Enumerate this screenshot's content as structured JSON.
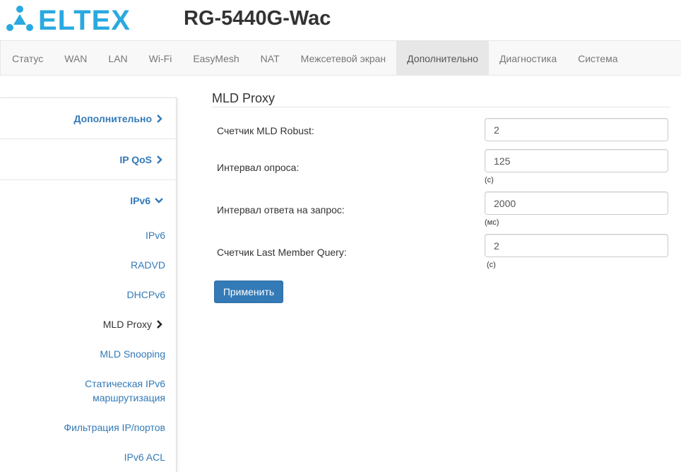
{
  "brand": {
    "logo_text": "ELTEX",
    "accent_color": "#2aa9e0"
  },
  "device_title": "RG-5440G-Wac",
  "nav": [
    {
      "label": "Статус",
      "active": false
    },
    {
      "label": "WAN",
      "active": false
    },
    {
      "label": "LAN",
      "active": false
    },
    {
      "label": "Wi-Fi",
      "active": false
    },
    {
      "label": "EasyMesh",
      "active": false
    },
    {
      "label": "NAT",
      "active": false
    },
    {
      "label": "Межсетевой экран",
      "active": false
    },
    {
      "label": "Дополнительно",
      "active": true
    },
    {
      "label": "Диагностика",
      "active": false
    },
    {
      "label": "Система",
      "active": false
    }
  ],
  "sidebar": {
    "groups": [
      {
        "label": "Дополнительно",
        "icon": "chevron-right-icon"
      },
      {
        "label": "IP QoS",
        "icon": "chevron-right-icon"
      },
      {
        "label": "IPv6",
        "icon": "chevron-down-icon"
      }
    ],
    "items": [
      {
        "label": "IPv6"
      },
      {
        "label": "RADVD"
      },
      {
        "label": "DHCPv6"
      },
      {
        "label": "MLD Proxy",
        "current": true,
        "icon": "chevron-right-icon"
      },
      {
        "label": "MLD Snooping"
      },
      {
        "label": "Статическая IPv6 маршрутизация"
      },
      {
        "label": "Фильтрация IP/портов"
      },
      {
        "label": "IPv6 ACL"
      }
    ]
  },
  "main": {
    "title": "MLD Proxy",
    "fields": [
      {
        "label": "Счетчик MLD Robust:",
        "value": "2",
        "unit": ""
      },
      {
        "label": "Интервал опроса:",
        "value": "125",
        "unit": "(с)"
      },
      {
        "label": "Интервал ответа на запрос:",
        "value": "2000",
        "unit": "(мс)"
      },
      {
        "label": "Счетчик Last Member Query:",
        "value": "2",
        "unit": "(с)"
      }
    ],
    "apply_label": "Применить"
  }
}
